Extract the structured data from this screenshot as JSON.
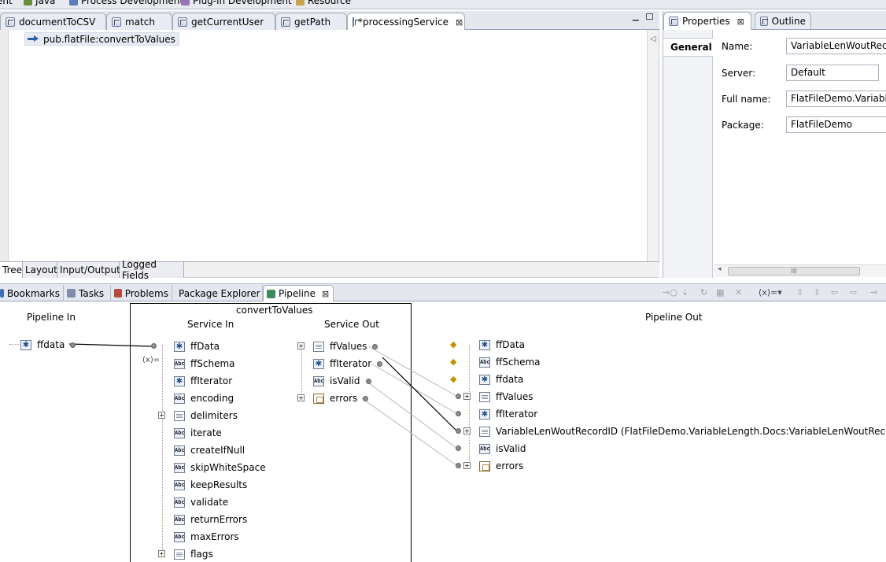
{
  "perspectives": [
    {
      "label": "ent",
      "icon": "perspective-icon"
    },
    {
      "label": "Java",
      "icon": "java-icon"
    },
    {
      "label": "Process Development",
      "icon": "process-icon"
    },
    {
      "label": "Plug-in Development",
      "icon": "plugin-icon"
    },
    {
      "label": "Resource",
      "icon": "resource-icon"
    }
  ],
  "editor": {
    "tabs": [
      {
        "label": "documentToCSV",
        "icon": "service-icon",
        "active": false
      },
      {
        "label": "match",
        "icon": "service-icon",
        "active": false
      },
      {
        "label": "getCurrentUser",
        "icon": "service-icon",
        "active": false
      },
      {
        "label": "getPath",
        "icon": "service-icon",
        "active": false
      },
      {
        "label": "*processingService",
        "icon": "flow-service-icon",
        "active": true,
        "close": "⊠"
      }
    ],
    "invoke_step": "pub.flatFile:convertToValues",
    "bottom_tabs": [
      "Tree",
      "Layout",
      "Input/Output",
      "Logged Fields"
    ],
    "active_bottom_tab": "Tree"
  },
  "properties": {
    "tabs": [
      {
        "label": "Properties",
        "close": "⊠"
      },
      {
        "label": "Outline"
      }
    ],
    "section": "General",
    "fields": [
      {
        "label": "Name:",
        "value": "VariableLenWoutRecor"
      },
      {
        "label": "Server:",
        "value": "Default"
      },
      {
        "label": "Full name:",
        "value": "FlatFileDemo.VariableL"
      },
      {
        "label": "Package:",
        "value": "FlatFileDemo"
      }
    ],
    "scroll_thumb": "III"
  },
  "bottom_tabs": [
    {
      "label": "Bookmarks",
      "icon": "bookmark-icon"
    },
    {
      "label": "Tasks",
      "icon": "tasks-icon"
    },
    {
      "label": "Problems",
      "icon": "problems-icon"
    },
    {
      "label": "Package Explorer",
      "icon": "package-icon"
    },
    {
      "label": "Pipeline",
      "icon": "pipeline-icon",
      "active": true,
      "close": "⊠"
    }
  ],
  "pipeline": {
    "pipeline_in_title": "Pipeline In",
    "pipeline_in": [
      {
        "label": "ffdata",
        "type": "object"
      }
    ],
    "service_name": "convertToValues",
    "service_in_title": "Service In",
    "service_in": [
      {
        "label": "ffData",
        "type": "object"
      },
      {
        "label": "ffSchema",
        "type": "string"
      },
      {
        "label": "ffIterator",
        "type": "object"
      },
      {
        "label": "encoding",
        "type": "string"
      },
      {
        "label": "delimiters",
        "type": "document",
        "expandable": true
      },
      {
        "label": "iterate",
        "type": "string"
      },
      {
        "label": "createIfNull",
        "type": "string"
      },
      {
        "label": "skipWhiteSpace",
        "type": "string"
      },
      {
        "label": "keepResults",
        "type": "string"
      },
      {
        "label": "validate",
        "type": "string"
      },
      {
        "label": "returnErrors",
        "type": "string"
      },
      {
        "label": "maxErrors",
        "type": "string"
      },
      {
        "label": "flags",
        "type": "document",
        "expandable": true
      }
    ],
    "service_out_title": "Service Out",
    "service_out": [
      {
        "label": "ffValues",
        "type": "document",
        "expandable": true
      },
      {
        "label": "ffIterator",
        "type": "object"
      },
      {
        "label": "isValid",
        "type": "string"
      },
      {
        "label": "errors",
        "type": "list",
        "expandable": true
      }
    ],
    "pipeline_out_title": "Pipeline Out",
    "pipeline_out": [
      {
        "label": "ffData",
        "type": "object",
        "hook": true
      },
      {
        "label": "ffSchema",
        "type": "string",
        "hook": true
      },
      {
        "label": "ffdata",
        "type": "object",
        "hook": true
      },
      {
        "label": "ffValues",
        "type": "document",
        "expandable": true
      },
      {
        "label": "ffIterator",
        "type": "object"
      },
      {
        "label": "VariableLenWoutRecordID (FlatFileDemo.VariableLength.Docs:VariableLenWoutRecordIDDT)",
        "type": "document",
        "expandable": true
      },
      {
        "label": "isValid",
        "type": "string"
      },
      {
        "label": "errors",
        "type": "list",
        "expandable": true
      }
    ],
    "set_value_icon": "(x)="
  }
}
